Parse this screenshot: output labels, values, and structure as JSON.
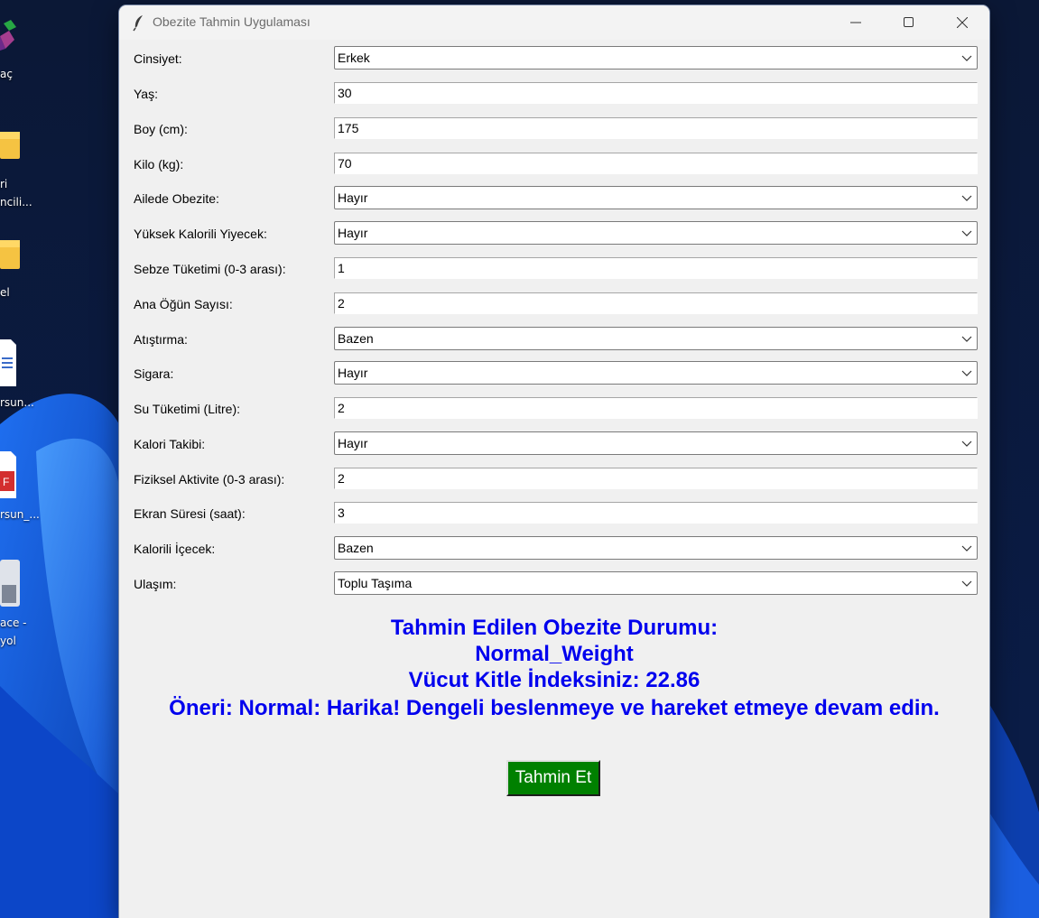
{
  "window": {
    "title": "Obezite Tahmin Uygulaması"
  },
  "desktop": {
    "icons": [
      {
        "label": "aç",
        "icon": "app-icon"
      },
      {
        "label": "ri",
        "label2": "ncili...",
        "icon": "folder-icon"
      },
      {
        "label": "el",
        "icon": "folder-icon"
      },
      {
        "label": "rsun...",
        "icon": "document-icon"
      },
      {
        "label": "rsun_...",
        "icon": "pdf-icon"
      },
      {
        "label": "ace -",
        "label2": "yol",
        "icon": "save-icon"
      }
    ]
  },
  "form": {
    "fields": [
      {
        "label": "Cinsiyet:",
        "type": "combo",
        "value": "Erkek"
      },
      {
        "label": "Yaş:",
        "type": "entry",
        "value": "30"
      },
      {
        "label": "Boy (cm):",
        "type": "entry",
        "value": "175"
      },
      {
        "label": "Kilo (kg):",
        "type": "entry",
        "value": "70"
      },
      {
        "label": "Ailede Obezite:",
        "type": "combo",
        "value": "Hayır"
      },
      {
        "label": "Yüksek Kalorili Yiyecek:",
        "type": "combo",
        "value": "Hayır"
      },
      {
        "label": "Sebze Tüketimi (0-3 arası):",
        "type": "entry",
        "value": "1"
      },
      {
        "label": "Ana Öğün Sayısı:",
        "type": "entry",
        "value": "2"
      },
      {
        "label": "Atıştırma:",
        "type": "combo",
        "value": "Bazen"
      },
      {
        "label": "Sigara:",
        "type": "combo",
        "value": "Hayır"
      },
      {
        "label": "Su Tüketimi (Litre):",
        "type": "entry",
        "value": "2"
      },
      {
        "label": "Kalori Takibi:",
        "type": "combo",
        "value": "Hayır"
      },
      {
        "label": "Fiziksel Aktivite (0-3 arası):",
        "type": "entry",
        "value": "2"
      },
      {
        "label": "Ekran Süresi (saat):",
        "type": "entry",
        "value": "3"
      },
      {
        "label": "Kalorili İçecek:",
        "type": "combo",
        "value": "Bazen"
      },
      {
        "label": "Ulaşım:",
        "type": "combo",
        "value": "Toplu Taşıma"
      }
    ]
  },
  "result": {
    "heading": "Tahmin Edilen Obezite Durumu:",
    "status": "Normal_Weight",
    "bmi": "Vücut Kitle İndeksiniz: 22.86",
    "advice": "Öneri: Normal: Harika! Dengeli beslenmeye ve hareket etmeye devam edin."
  },
  "button": {
    "predict_label": "Tahmin Et"
  },
  "colors": {
    "result_text": "#0000ee",
    "button_bg": "#008000",
    "window_bg": "#f0f0f0"
  }
}
